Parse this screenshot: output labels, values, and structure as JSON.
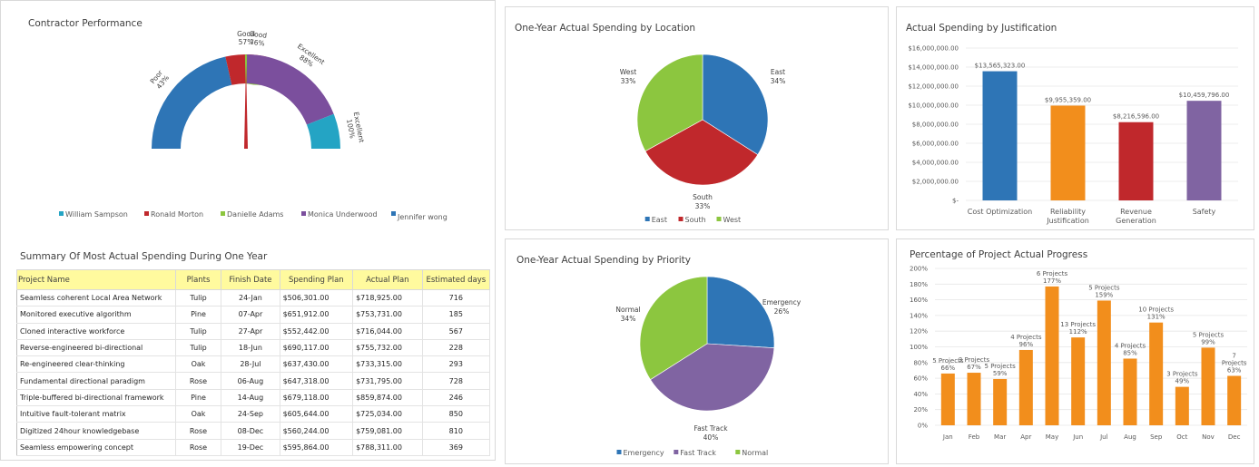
{
  "contractor": {
    "title": "Contractor Performance",
    "segments": [
      {
        "name": "William Sampson",
        "label": "Poor",
        "pct": "43%",
        "value": 43,
        "color": "#2e75b6"
      },
      {
        "name": "Ronald Morton",
        "label": "Good",
        "pct": "57%",
        "value": 57,
        "color": "#c0282c"
      },
      {
        "name": "Danielle Adams",
        "label": "Good",
        "pct": "76%",
        "value": 76,
        "color": "#8cc63f"
      },
      {
        "name": "Monica Underwood",
        "label": "Excellent",
        "pct": "88%",
        "value": 88,
        "color": "#7b4f9d"
      },
      {
        "name": "Jennifer wong",
        "label": "Excellent",
        "pct": "100%",
        "value": 100,
        "color": "#24a4c4"
      }
    ],
    "legend_colors": [
      "#24a4c4",
      "#c0282c",
      "#8cc63f",
      "#7b4f9d",
      "#2e75b6"
    ],
    "needle_color": "#c0282c"
  },
  "summary": {
    "title": "Summary Of Most Actual Spending During One Year",
    "headers": [
      "Project Name",
      "Plants",
      "Finish Date",
      "Spending Plan",
      "Actual Plan",
      "Estimated days"
    ],
    "rows": [
      [
        "Seamless coherent Local Area Network",
        "Tulip",
        "24-Jan",
        "$506,301.00",
        "$718,925.00",
        "716"
      ],
      [
        "Monitored executive algorithm",
        "Pine",
        "07-Apr",
        "$651,912.00",
        "$753,731.00",
        "185"
      ],
      [
        "Cloned interactive workforce",
        "Tulip",
        "27-Apr",
        "$552,442.00",
        "$716,044.00",
        "567"
      ],
      [
        "Reverse-engineered bi-directional",
        "Tulip",
        "18-Jun",
        "$690,117.00",
        "$755,732.00",
        "228"
      ],
      [
        "Re-engineered clear-thinking",
        "Oak",
        "28-Jul",
        "$637,430.00",
        "$733,315.00",
        "293"
      ],
      [
        "Fundamental directional paradigm",
        "Rose",
        "06-Aug",
        "$647,318.00",
        "$731,795.00",
        "728"
      ],
      [
        "Triple-buffered bi-directional framework",
        "Pine",
        "14-Aug",
        "$679,118.00",
        "$859,874.00",
        "246"
      ],
      [
        "Intuitive fault-tolerant matrix",
        "Oak",
        "24-Sep",
        "$605,644.00",
        "$725,034.00",
        "850"
      ],
      [
        "Digitized 24hour knowledgebase",
        "Rose",
        "08-Dec",
        "$560,244.00",
        "$759,081.00",
        "810"
      ],
      [
        "Seamless empowering concept",
        "Rose",
        "19-Dec",
        "$595,864.00",
        "$788,311.00",
        "369"
      ]
    ]
  },
  "chart_data": [
    {
      "type": "pie",
      "title": "One-Year Actual Spending by Location",
      "categories": [
        "East",
        "South",
        "West"
      ],
      "values": [
        34,
        33,
        33
      ],
      "labels": [
        "34%",
        "33%",
        "33%"
      ],
      "colors": [
        "#2e75b6",
        "#c0282c",
        "#8cc63f"
      ],
      "legend": "bottom"
    },
    {
      "type": "bar",
      "title": "Actual Spending by Justification",
      "categories": [
        "Cost Optimization",
        "Reliability Justification",
        "Revenue Generation",
        "Safety"
      ],
      "category_lines": [
        [
          "Cost Optimization"
        ],
        [
          "Reliability",
          "Justification"
        ],
        [
          "Revenue",
          "Generation"
        ],
        [
          "Safety"
        ]
      ],
      "values": [
        13565323,
        9955359,
        8216596,
        10459796
      ],
      "data_labels": [
        "$13,565,323.00",
        "$9,955,359.00",
        "$8,216,596.00",
        "$10,459,796.00"
      ],
      "colors": [
        "#2e75b6",
        "#f28e1c",
        "#c0282c",
        "#8064a2"
      ],
      "ylim": [
        0,
        16000000
      ],
      "yticks": [
        "$-",
        "$2,000,000.00",
        "$4,000,000.00",
        "$6,000,000.00",
        "$8,000,000.00",
        "$10,000,000.00",
        "$12,000,000.00",
        "$14,000,000.00",
        "$16,000,000.00"
      ],
      "grid": true
    },
    {
      "type": "pie",
      "title": "One-Year Actual Spending by Priority",
      "categories": [
        "Emergency",
        "Fast Track",
        "Normal"
      ],
      "values": [
        26,
        40,
        34
      ],
      "labels": [
        "26%",
        "40%",
        "34%"
      ],
      "colors": [
        "#2e75b6",
        "#8064a2",
        "#8cc63f"
      ],
      "legend": "bottom"
    },
    {
      "type": "bar",
      "title": "Percentage of Project Actual Progress",
      "categories": [
        "Jan",
        "Feb",
        "Mar",
        "Apr",
        "May",
        "Jun",
        "Jul",
        "Aug",
        "Sep",
        "Oct",
        "Nov",
        "Dec"
      ],
      "values": [
        66,
        67,
        59,
        96,
        177,
        112,
        159,
        85,
        131,
        49,
        99,
        63
      ],
      "data_labels": [
        [
          "5 Projects",
          "66%"
        ],
        [
          "3 Projects",
          "67%"
        ],
        [
          "5 Projects",
          "59%"
        ],
        [
          "4 Projects",
          "96%"
        ],
        [
          "6 Projects",
          "177%"
        ],
        [
          "13 Projects",
          "112%"
        ],
        [
          "5 Projects",
          "159%"
        ],
        [
          "4 Projects",
          "85%"
        ],
        [
          "10 Projects",
          "131%"
        ],
        [
          "3 Projects",
          "49%"
        ],
        [
          "5 Projects",
          "99%"
        ],
        [
          "7",
          "Projects",
          "63%"
        ]
      ],
      "color": "#f28e1c",
      "ylim": [
        0,
        200
      ],
      "yticks": [
        "0%",
        "20%",
        "40%",
        "60%",
        "80%",
        "100%",
        "120%",
        "140%",
        "160%",
        "180%",
        "200%"
      ],
      "grid": true
    }
  ]
}
